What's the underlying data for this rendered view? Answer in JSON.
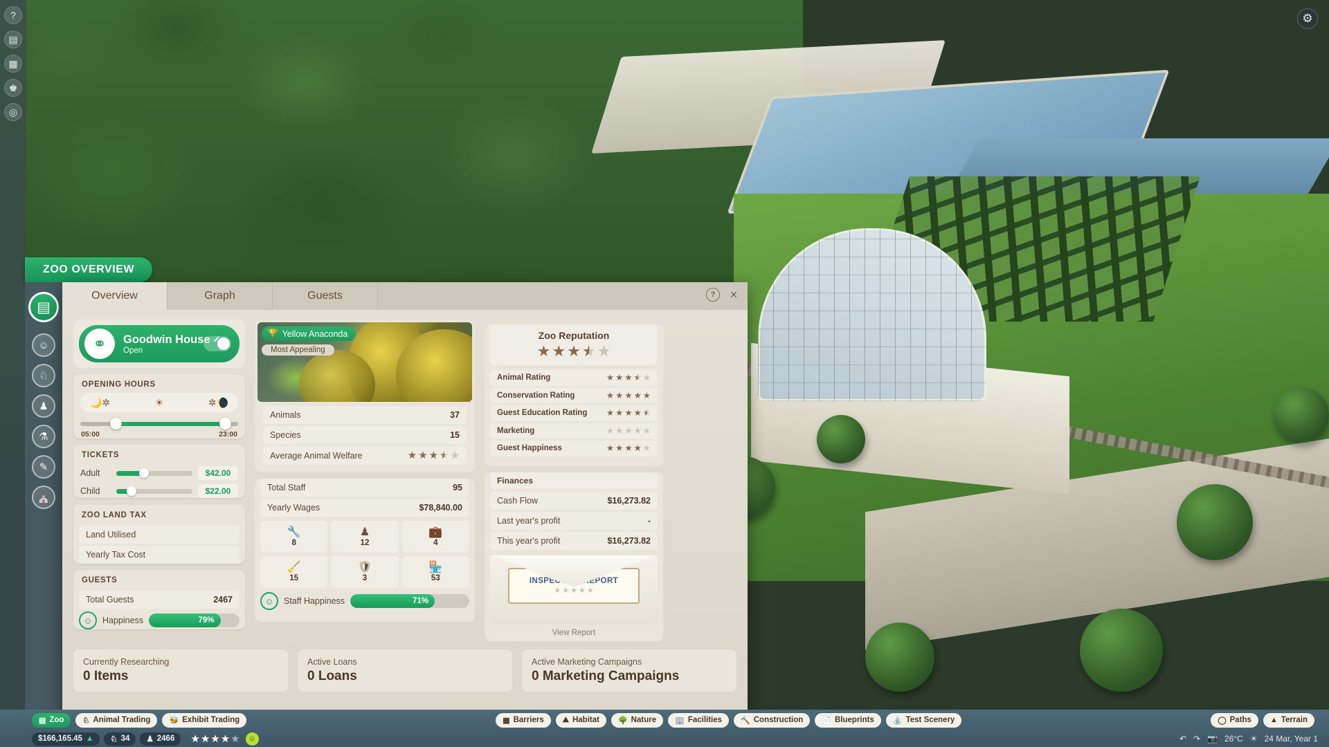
{
  "window": {
    "overlay_title": "ZOO OVERVIEW",
    "tabs": [
      {
        "label": "Overview",
        "active": true
      },
      {
        "label": "Graph",
        "active": false
      },
      {
        "label": "Guests",
        "active": false
      }
    ],
    "help_icon": "question-mark-icon",
    "close_icon": "close-icon"
  },
  "zoo": {
    "name": "Goodwin House",
    "status": "Open",
    "edit_icon": "pencil-icon",
    "logo_icon": "zoo-logo-icon",
    "toggle_state": "on"
  },
  "opening_hours": {
    "title": "OPENING HOURS",
    "open_time": "05:00",
    "close_time": "23:00",
    "night_icon_left": "moon-stars-icon",
    "day_icon": "sun-icon",
    "night_icon_right": "moon-stars-icon"
  },
  "tickets": {
    "title": "TICKETS",
    "items": [
      {
        "label": "Adult",
        "price": "$42.00",
        "fill_pct": 34
      },
      {
        "label": "Child",
        "price": "$22.00",
        "fill_pct": 18
      }
    ]
  },
  "land_tax": {
    "title": "ZOO LAND TAX",
    "rows": [
      {
        "label": "Land Utilised",
        "value": ""
      },
      {
        "label": "Yearly Tax Cost",
        "value": ""
      }
    ]
  },
  "guests": {
    "title": "GUESTS",
    "total_label": "Total Guests",
    "total_value": "2467",
    "happiness_label": "Happiness",
    "happiness_pct": "79%",
    "happiness_value": 79,
    "smiley_icon": "smiley-face-icon"
  },
  "featured_animal": {
    "trophy_icon": "trophy-icon",
    "name": "Yellow Anaconda",
    "tag": "Most Appealing",
    "rows": [
      {
        "label": "Animals",
        "value": "37"
      },
      {
        "label": "Species",
        "value": "15"
      }
    ],
    "welfare_label": "Average Animal Welfare",
    "welfare_stars": 3.5
  },
  "staff": {
    "total_label": "Total Staff",
    "total_value": "95",
    "wages_label": "Yearly Wages",
    "wages_value": "$78,840.00",
    "cells": [
      {
        "icon": "wrench-icon",
        "glyph": "⚒",
        "count": "8",
        "role": "mechanic"
      },
      {
        "icon": "keeper-hat-icon",
        "glyph": "♟",
        "count": "12",
        "role": "keeper"
      },
      {
        "icon": "vet-bag-icon",
        "glyph": "⛨",
        "count": "4",
        "role": "vet"
      },
      {
        "icon": "broom-icon",
        "glyph": "✐",
        "count": "15",
        "role": "caretaker"
      },
      {
        "icon": "security-shield-icon",
        "glyph": "★",
        "count": "3",
        "role": "security"
      },
      {
        "icon": "vendor-stall-icon",
        "glyph": "⛺",
        "count": "53",
        "role": "vendor"
      }
    ],
    "happiness_label": "Staff Happiness",
    "happiness_pct": "71%",
    "happiness_value": 71,
    "smiley_icon": "smiley-face-icon"
  },
  "reputation": {
    "title": "Zoo Reputation",
    "overall_stars": 3.5,
    "rows": [
      {
        "label": "Animal Rating",
        "stars": 3.5
      },
      {
        "label": "Conservation Rating",
        "stars": 5
      },
      {
        "label": "Guest Education Rating",
        "stars": 4.5
      },
      {
        "label": "Marketing",
        "stars": 0
      },
      {
        "label": "Guest Happiness",
        "stars": 4
      }
    ]
  },
  "finances": {
    "title": "Finances",
    "rows": [
      {
        "label": "Cash Flow",
        "value": "$16,273.82"
      },
      {
        "label": "Last year's profit",
        "value": "-"
      },
      {
        "label": "This year's profit",
        "value": "$16,273.82"
      }
    ]
  },
  "inspection": {
    "title": "INSPECTION REPORT",
    "stars": 0,
    "view_label": "View Report",
    "seal_icon": "seal-icon"
  },
  "bottom_cards": [
    {
      "label": "Currently Researching",
      "value": "0 Items"
    },
    {
      "label": "Active Loans",
      "value": "0 Loans"
    },
    {
      "label": "Active Marketing Campaigns",
      "value": "0 Marketing Campaigns"
    }
  ],
  "left_rail": [
    {
      "icon": "help-icon",
      "glyph": "?"
    },
    {
      "icon": "notebook-icon",
      "glyph": "☷"
    },
    {
      "icon": "calendar-icon",
      "glyph": "☷"
    },
    {
      "icon": "trophy-icon",
      "glyph": "♚"
    },
    {
      "icon": "target-icon",
      "glyph": "◎"
    }
  ],
  "panel_rail": [
    {
      "icon": "zoo-overview-icon",
      "glyph": "☷",
      "active": true
    },
    {
      "icon": "guest-icon",
      "glyph": "☺"
    },
    {
      "icon": "paw-icon",
      "glyph": "☘"
    },
    {
      "icon": "staff-icon",
      "glyph": "♟"
    },
    {
      "icon": "research-icon",
      "glyph": "⚗"
    },
    {
      "icon": "finance-icon",
      "glyph": "✎"
    },
    {
      "icon": "shop-icon",
      "glyph": "⛺"
    }
  ],
  "hud": {
    "gear_icon": "gear-icon",
    "left_buttons": [
      {
        "label": "Zoo",
        "icon": "zoo-icon",
        "active": true
      },
      {
        "label": "Animal Trading",
        "icon": "paw-icon",
        "active": false
      },
      {
        "label": "Exhibit Trading",
        "icon": "beetle-icon",
        "active": false
      }
    ],
    "center_buttons": [
      {
        "label": "Barriers",
        "icon": "fence-icon"
      },
      {
        "label": "Habitat",
        "icon": "habitat-icon"
      },
      {
        "label": "Nature",
        "icon": "tree-icon"
      },
      {
        "label": "Facilities",
        "icon": "building-icon"
      },
      {
        "label": "Construction",
        "icon": "hammer-icon"
      },
      {
        "label": "Blueprints",
        "icon": "blueprint-icon"
      },
      {
        "label": "Test Scenery",
        "icon": "scenery-icon"
      }
    ],
    "right_buttons": [
      {
        "label": "Paths",
        "icon": "path-icon"
      },
      {
        "label": "Terrain",
        "icon": "terrain-icon"
      }
    ],
    "money": "$166,165.45",
    "money_trend": "▲",
    "species_count": "34",
    "guest_count": "2466",
    "star_rating": 3.5,
    "mood_icon": "smiley-face-icon",
    "temperature": "26°C",
    "weather_icon": "sun-icon",
    "date": "24 Mar, Year 1",
    "undo_icon": "undo-icon",
    "redo_icon": "redo-icon",
    "camera_icon": "camera-icon"
  },
  "colors": {
    "accent_green": "#22a563",
    "panel_bg": "#e4e0d5",
    "card_bg": "#e9e5db",
    "text_brown": "#5b4734",
    "star_brown": "#8a6a4d",
    "hud_blue": "#3e5665"
  }
}
